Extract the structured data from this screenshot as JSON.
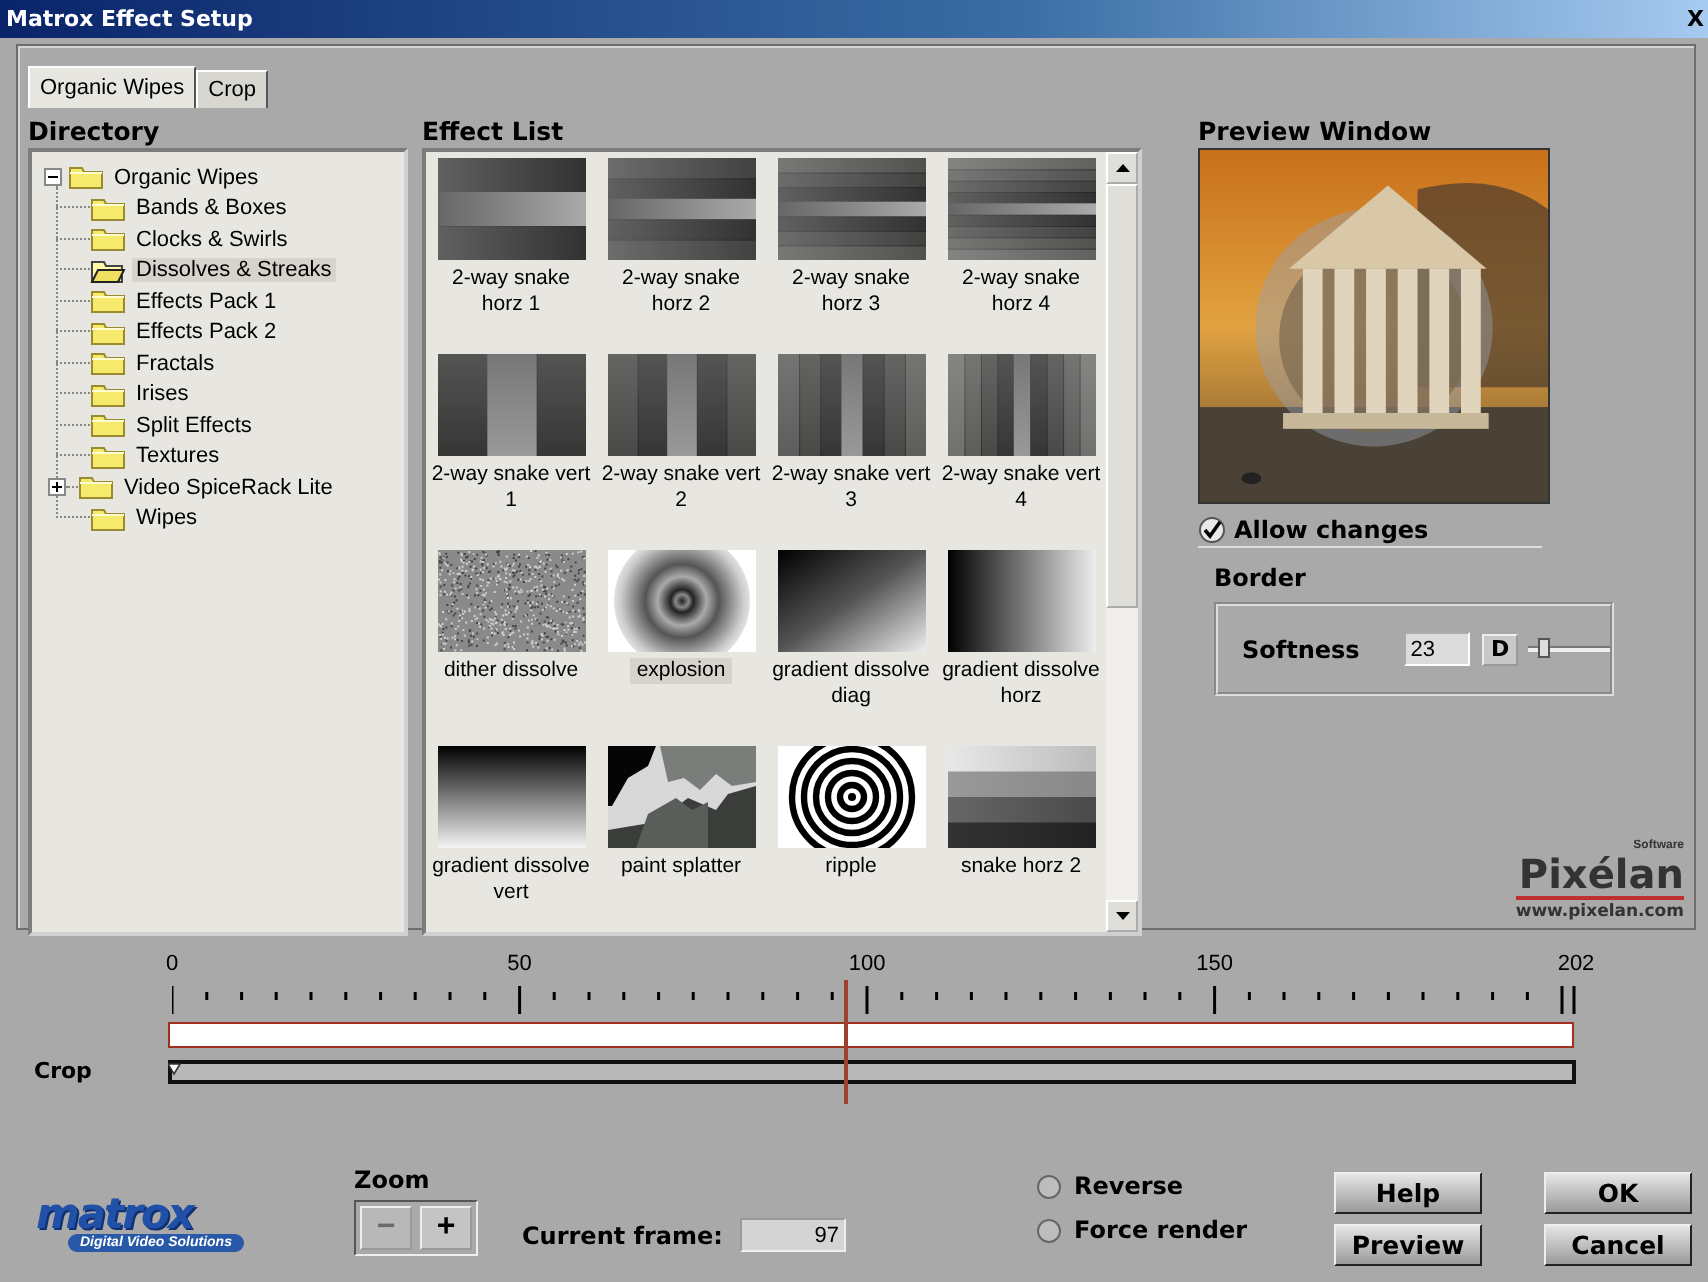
{
  "window": {
    "title": "Matrox Effect Setup",
    "close_button": "X"
  },
  "tabs": [
    {
      "label": "Organic Wipes",
      "selected": true
    },
    {
      "label": "Crop",
      "selected": false
    }
  ],
  "directory": {
    "heading": "Directory",
    "tree": {
      "label": "Organic Wipes",
      "kind": "group",
      "expanded": true,
      "selected": false,
      "children": [
        {
          "label": "Bands & Boxes",
          "kind": "folder",
          "selected": false
        },
        {
          "label": "Clocks & Swirls",
          "kind": "folder",
          "selected": false
        },
        {
          "label": "Dissolves & Streaks",
          "kind": "folder",
          "selected": true
        },
        {
          "label": "Effects Pack 1",
          "kind": "folder",
          "selected": false
        },
        {
          "label": "Effects Pack 2",
          "kind": "folder",
          "selected": false
        },
        {
          "label": "Fractals",
          "kind": "folder",
          "selected": false
        },
        {
          "label": "Irises",
          "kind": "folder",
          "selected": false
        },
        {
          "label": "Split Effects",
          "kind": "folder",
          "selected": false
        },
        {
          "label": "Textures",
          "kind": "folder",
          "selected": false
        },
        {
          "label": "Video SpiceRack Lite",
          "kind": "group",
          "expanded": false,
          "selected": false
        },
        {
          "label": "Wipes",
          "kind": "folder",
          "selected": false
        }
      ]
    }
  },
  "effect_list": {
    "heading": "Effect List",
    "items": [
      {
        "label": "2-way snake horz 1",
        "kind": "snake-horz",
        "selected": false
      },
      {
        "label": "2-way snake horz 2",
        "kind": "snake-horz",
        "selected": false
      },
      {
        "label": "2-way snake horz 3",
        "kind": "snake-horz",
        "selected": false
      },
      {
        "label": "2-way snake horz 4",
        "kind": "snake-horz",
        "selected": false
      },
      {
        "label": "2-way snake vert 1",
        "kind": "snake-vert",
        "selected": false
      },
      {
        "label": "2-way snake vert 2",
        "kind": "snake-vert",
        "selected": false
      },
      {
        "label": "2-way snake vert 3",
        "kind": "snake-vert",
        "selected": false
      },
      {
        "label": "2-way snake vert 4",
        "kind": "snake-vert",
        "selected": false
      },
      {
        "label": "dither dissolve",
        "kind": "noise",
        "selected": false
      },
      {
        "label": "explosion",
        "kind": "radial",
        "selected": true
      },
      {
        "label": "gradient dissolve diag",
        "kind": "gradient-diag",
        "selected": false
      },
      {
        "label": "gradient dissolve horz",
        "kind": "gradient-horz",
        "selected": false
      },
      {
        "label": "gradient dissolve vert",
        "kind": "gradient-vert",
        "selected": false
      },
      {
        "label": "paint splatter",
        "kind": "splatter",
        "selected": false
      },
      {
        "label": "ripple",
        "kind": "ripple",
        "selected": false
      },
      {
        "label": "snake horz 2",
        "kind": "bands",
        "selected": false
      }
    ]
  },
  "preview": {
    "heading": "Preview Window",
    "allow_changes": {
      "label": "Allow changes",
      "checked": true
    },
    "border": {
      "heading": "Border",
      "softness": {
        "label": "Softness",
        "value": "23",
        "default_button": "D",
        "level": 0.2
      }
    }
  },
  "pixelan_logo": {
    "wordmark": "Pixélan",
    "tagline": "Software",
    "url": "www.pixelan.com"
  },
  "timeline": {
    "ticks": [
      "0",
      "50",
      "100",
      "150",
      "202"
    ],
    "level": 0.48,
    "crop_label": "Crop"
  },
  "matrox_logo": {
    "wordmark": "matrox",
    "tagline": "Digital Video Solutions"
  },
  "zoom": {
    "label": "Zoom",
    "buttons": [
      {
        "label": "−",
        "disabled": true
      },
      {
        "label": "+",
        "disabled": false
      }
    ]
  },
  "current_frame": {
    "label": "Current frame:",
    "value": "97"
  },
  "options": [
    {
      "label": "Reverse",
      "checked": false
    },
    {
      "label": "Force render",
      "checked": false
    }
  ],
  "buttons": [
    "Help",
    "Preview",
    "OK",
    "Cancel"
  ]
}
